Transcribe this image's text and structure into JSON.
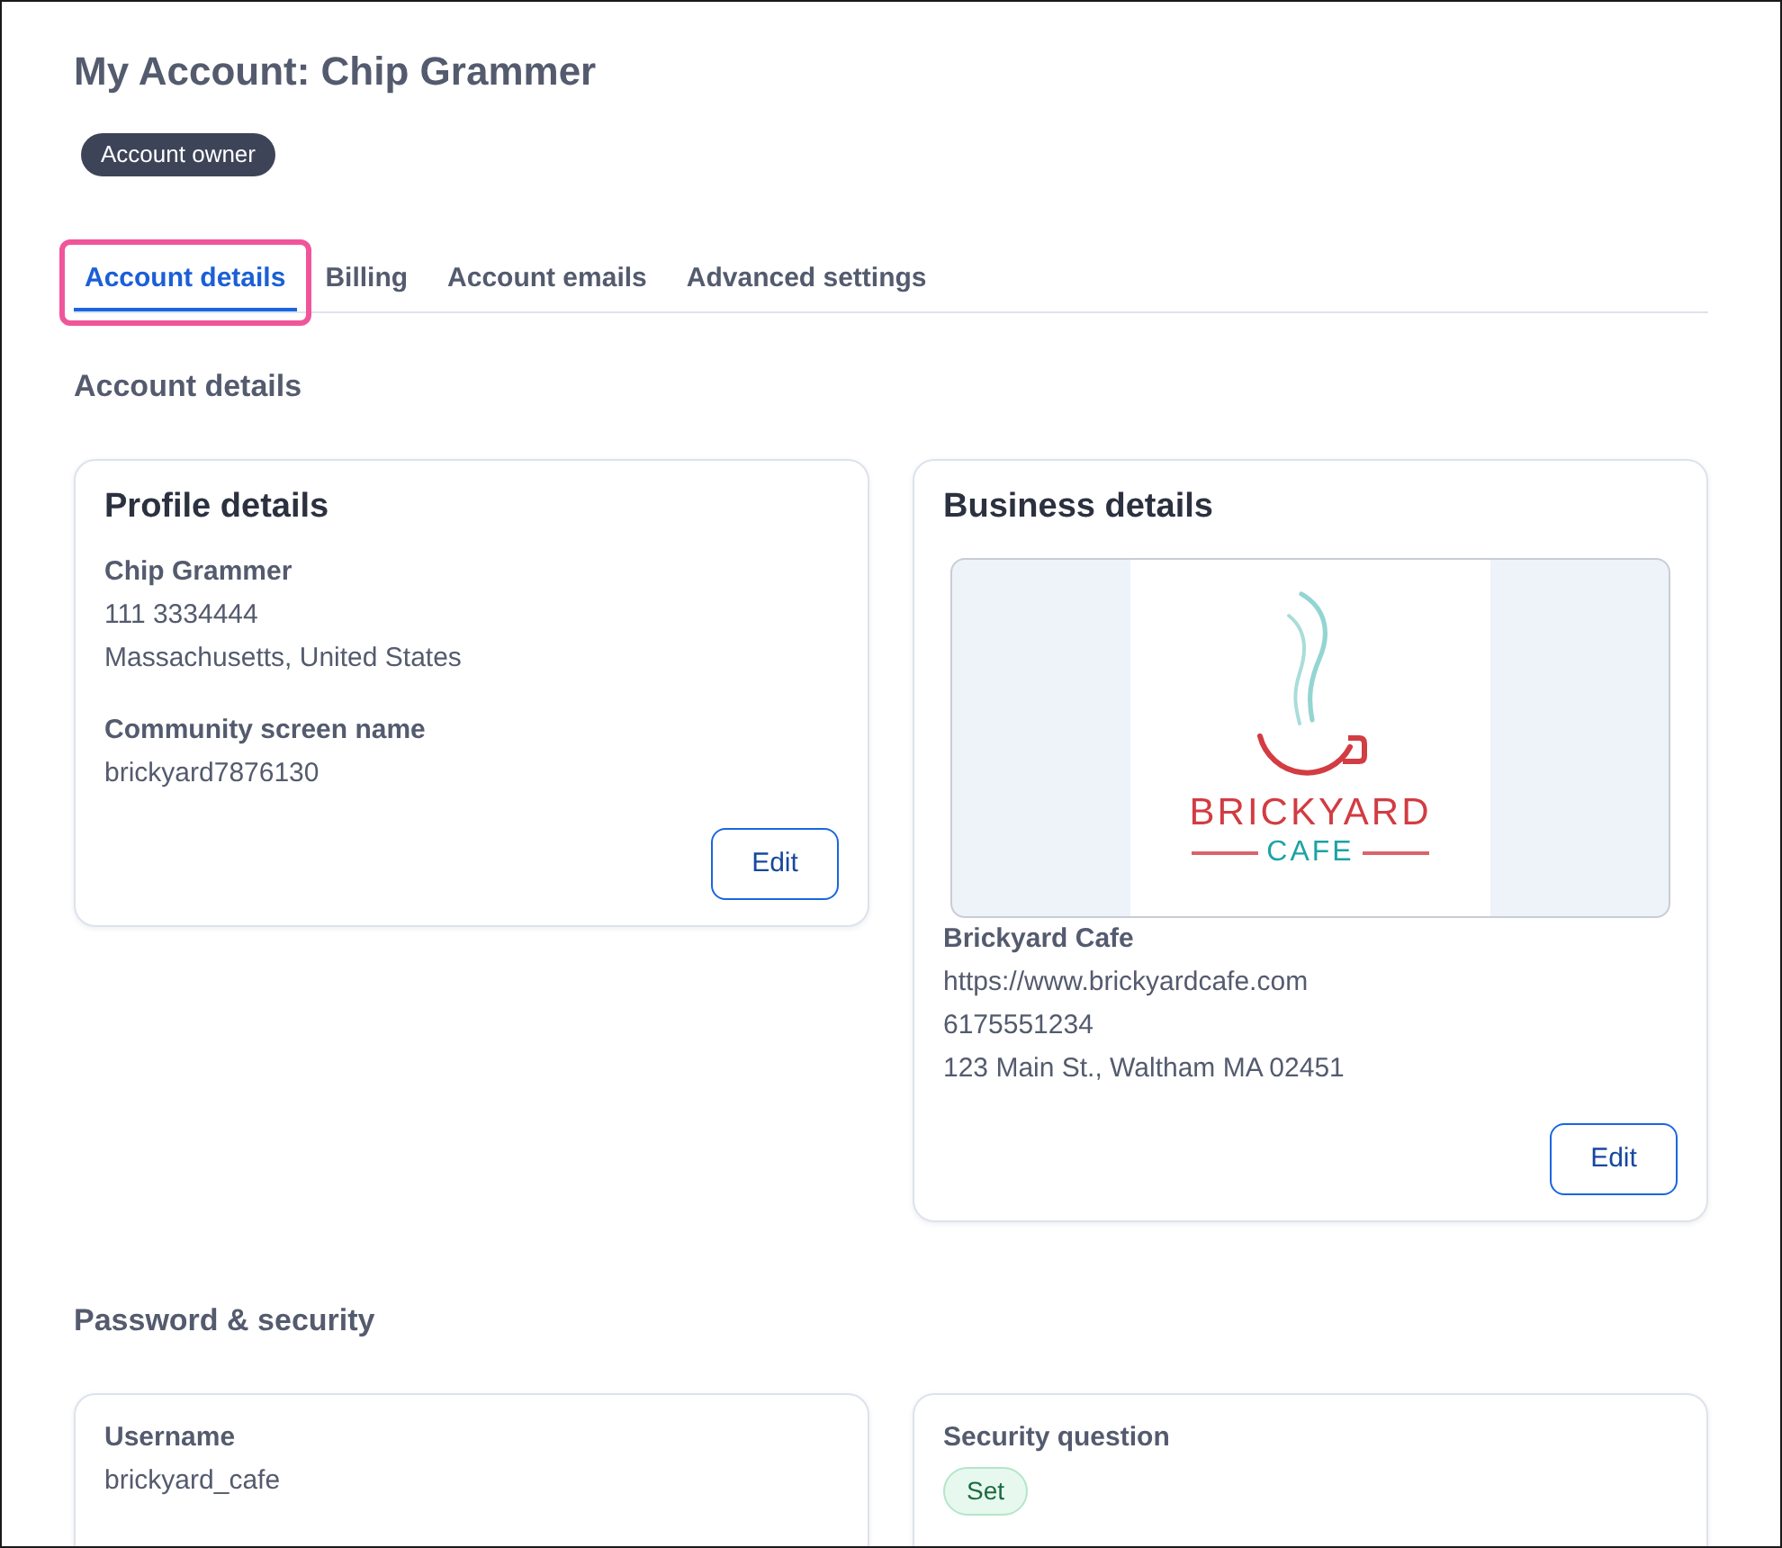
{
  "header": {
    "title": "My Account: Chip Grammer",
    "badge": "Account owner"
  },
  "tabs": [
    {
      "label": "Account details",
      "selected": true,
      "highlighted": true
    },
    {
      "label": "Billing",
      "selected": false,
      "highlighted": false
    },
    {
      "label": "Account emails",
      "selected": false,
      "highlighted": false
    },
    {
      "label": "Advanced settings",
      "selected": false,
      "highlighted": false
    }
  ],
  "sections": [
    {
      "heading": "Account details",
      "cards": [
        {
          "title": "Profile details",
          "blocks": [
            {
              "label": "Chip Grammer",
              "values": [
                "111 3334444",
                "Massachusetts, United States"
              ]
            },
            {
              "label": "Community screen name",
              "values": [
                "brickyard7876130"
              ]
            }
          ],
          "button": "Edit"
        },
        {
          "title": "Business details",
          "logo": {
            "name": "BRICKYARD",
            "tagline": "CAFE"
          },
          "blocks": [
            {
              "label": "Brickyard Cafe",
              "values": [
                "https://www.brickyardcafe.com",
                "6175551234",
                "123 Main St., Waltham MA 02451"
              ]
            }
          ],
          "button": "Edit"
        }
      ]
    },
    {
      "heading": "Password & security",
      "cards": [
        {
          "blocks": [
            {
              "label": "Username",
              "values": [
                "brickyard_cafe"
              ]
            }
          ]
        },
        {
          "blocks": [
            {
              "label": "Security question",
              "badge": "Set"
            }
          ]
        }
      ]
    }
  ]
}
